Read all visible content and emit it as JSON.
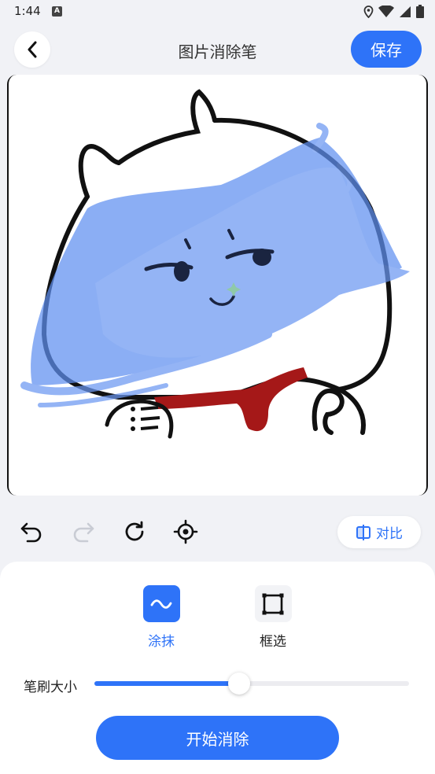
{
  "status_bar": {
    "time": "1:44",
    "notification_badge": "A"
  },
  "header": {
    "title": "图片消除笔",
    "save_label": "保存"
  },
  "toolbar": {
    "compare_label": "对比"
  },
  "modes": [
    {
      "label": "涂抹",
      "icon": "smear-wave-icon",
      "active": true
    },
    {
      "label": "框选",
      "icon": "box-select-icon",
      "active": false
    }
  ],
  "brush": {
    "label": "笔刷大小",
    "value_percent": 46
  },
  "actions": {
    "start_label": "开始消除"
  },
  "colors": {
    "accent": "#2e73f8",
    "brush_overlay": "#7ea3f4",
    "background": "#f1f2f6"
  }
}
